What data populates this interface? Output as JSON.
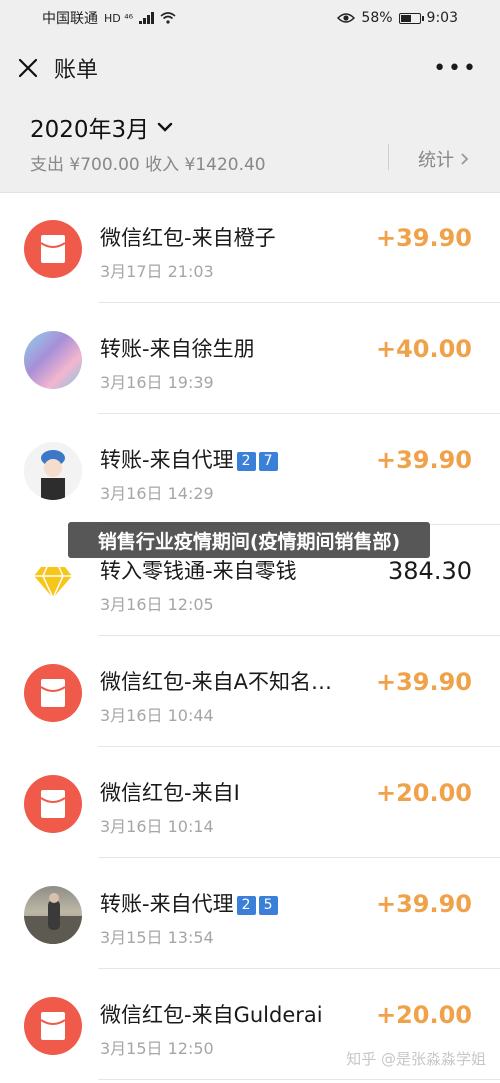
{
  "status_bar": {
    "carrier": "中国联通",
    "network": "HD ⁴⁶",
    "battery": "58%",
    "battery_level": 0.58,
    "time": "9:03"
  },
  "nav": {
    "title": "账单",
    "close_icon": "close-icon",
    "more_icon": "more-icon"
  },
  "summary": {
    "month": "2020年3月",
    "totals": "支出 ¥700.00 收入 ¥1420.40",
    "stats_label": "统计"
  },
  "transactions": [
    {
      "title": "微信红包-来自橙子",
      "date": "3月17日 21:03",
      "amount": "+39.90",
      "avatar": "red-packet-icon"
    },
    {
      "title": "转账-来自徐生朋",
      "date": "3月16日 19:39",
      "amount": "+40.00",
      "avatar": "user-avatar"
    },
    {
      "title": "转账-来自代理",
      "emoji": [
        "2",
        "7"
      ],
      "date": "3月16日 14:29",
      "amount": "+39.90",
      "avatar": "user-avatar"
    },
    {
      "title": "转入零钱通-来自零钱",
      "date": "3月16日 12:05",
      "amount": "384.30",
      "avatar": "diamond-icon"
    },
    {
      "title": "微信红包-来自A不知名…",
      "date": "3月16日 10:44",
      "amount": "+39.90",
      "avatar": "red-packet-icon"
    },
    {
      "title": "微信红包-来自I",
      "date": "3月16日 10:14",
      "amount": "+20.00",
      "avatar": "red-packet-icon"
    },
    {
      "title": "转账-来自代理",
      "emoji": [
        "2",
        "5"
      ],
      "date": "3月15日 13:54",
      "amount": "+39.90",
      "avatar": "user-avatar"
    },
    {
      "title": "微信红包-来自Gulderai",
      "date": "3月15日 12:50",
      "amount": "+20.00",
      "avatar": "red-packet-icon"
    }
  ],
  "overlay_banner": "销售行业疫情期间(疫情期间销售部)",
  "watermark": "知乎 @是张淼淼学姐",
  "colors": {
    "income": "#f0a24a",
    "red_packet": "#f05a4a",
    "header_bg": "#efefef"
  }
}
